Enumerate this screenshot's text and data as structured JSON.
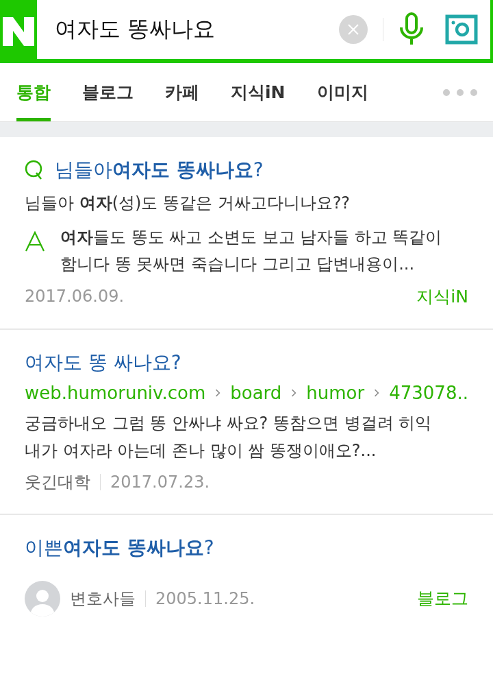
{
  "search": {
    "value": "여자도 똥싸나요"
  },
  "tabs": [
    {
      "label": "통합",
      "selected": true
    },
    {
      "label": "블로그",
      "selected": false
    },
    {
      "label": "카페",
      "selected": false
    },
    {
      "label": "지식iN",
      "selected": false
    },
    {
      "label": "이미지",
      "selected": false
    }
  ],
  "results": [
    {
      "kind": "qna",
      "title": "님들아**여자도 똥싸나요**?",
      "question": "님들아 **여자**(성)도 똥같은 거싸고다니나요??",
      "answer": "**여자**들도 똥도 싸고 소변도 보고 남자들 하고 똑같이 함니다 똥 못싸면 죽습니다 그리고 답변내용이...",
      "date": "2017.06.09.",
      "source": "지식iN"
    },
    {
      "kind": "web",
      "title": "여자도 똥 싸나요?",
      "url": [
        "web.humoruniv.com",
        "board",
        "humor",
        "473078.."
      ],
      "snippet": "궁금하내오 그럼 똥 안싸냐 싸요? 똥참으면 병걸려 히익 내가 여자라 아는데 존나 많이 쌈 똥쟁이애오?...",
      "site": "웃긴대학",
      "date": "2017.07.23."
    },
    {
      "kind": "blog",
      "title": "이쁜**여자도 똥싸나요**?",
      "author": "변호사들",
      "date": "2005.11.25.",
      "source": "블로그"
    }
  ]
}
